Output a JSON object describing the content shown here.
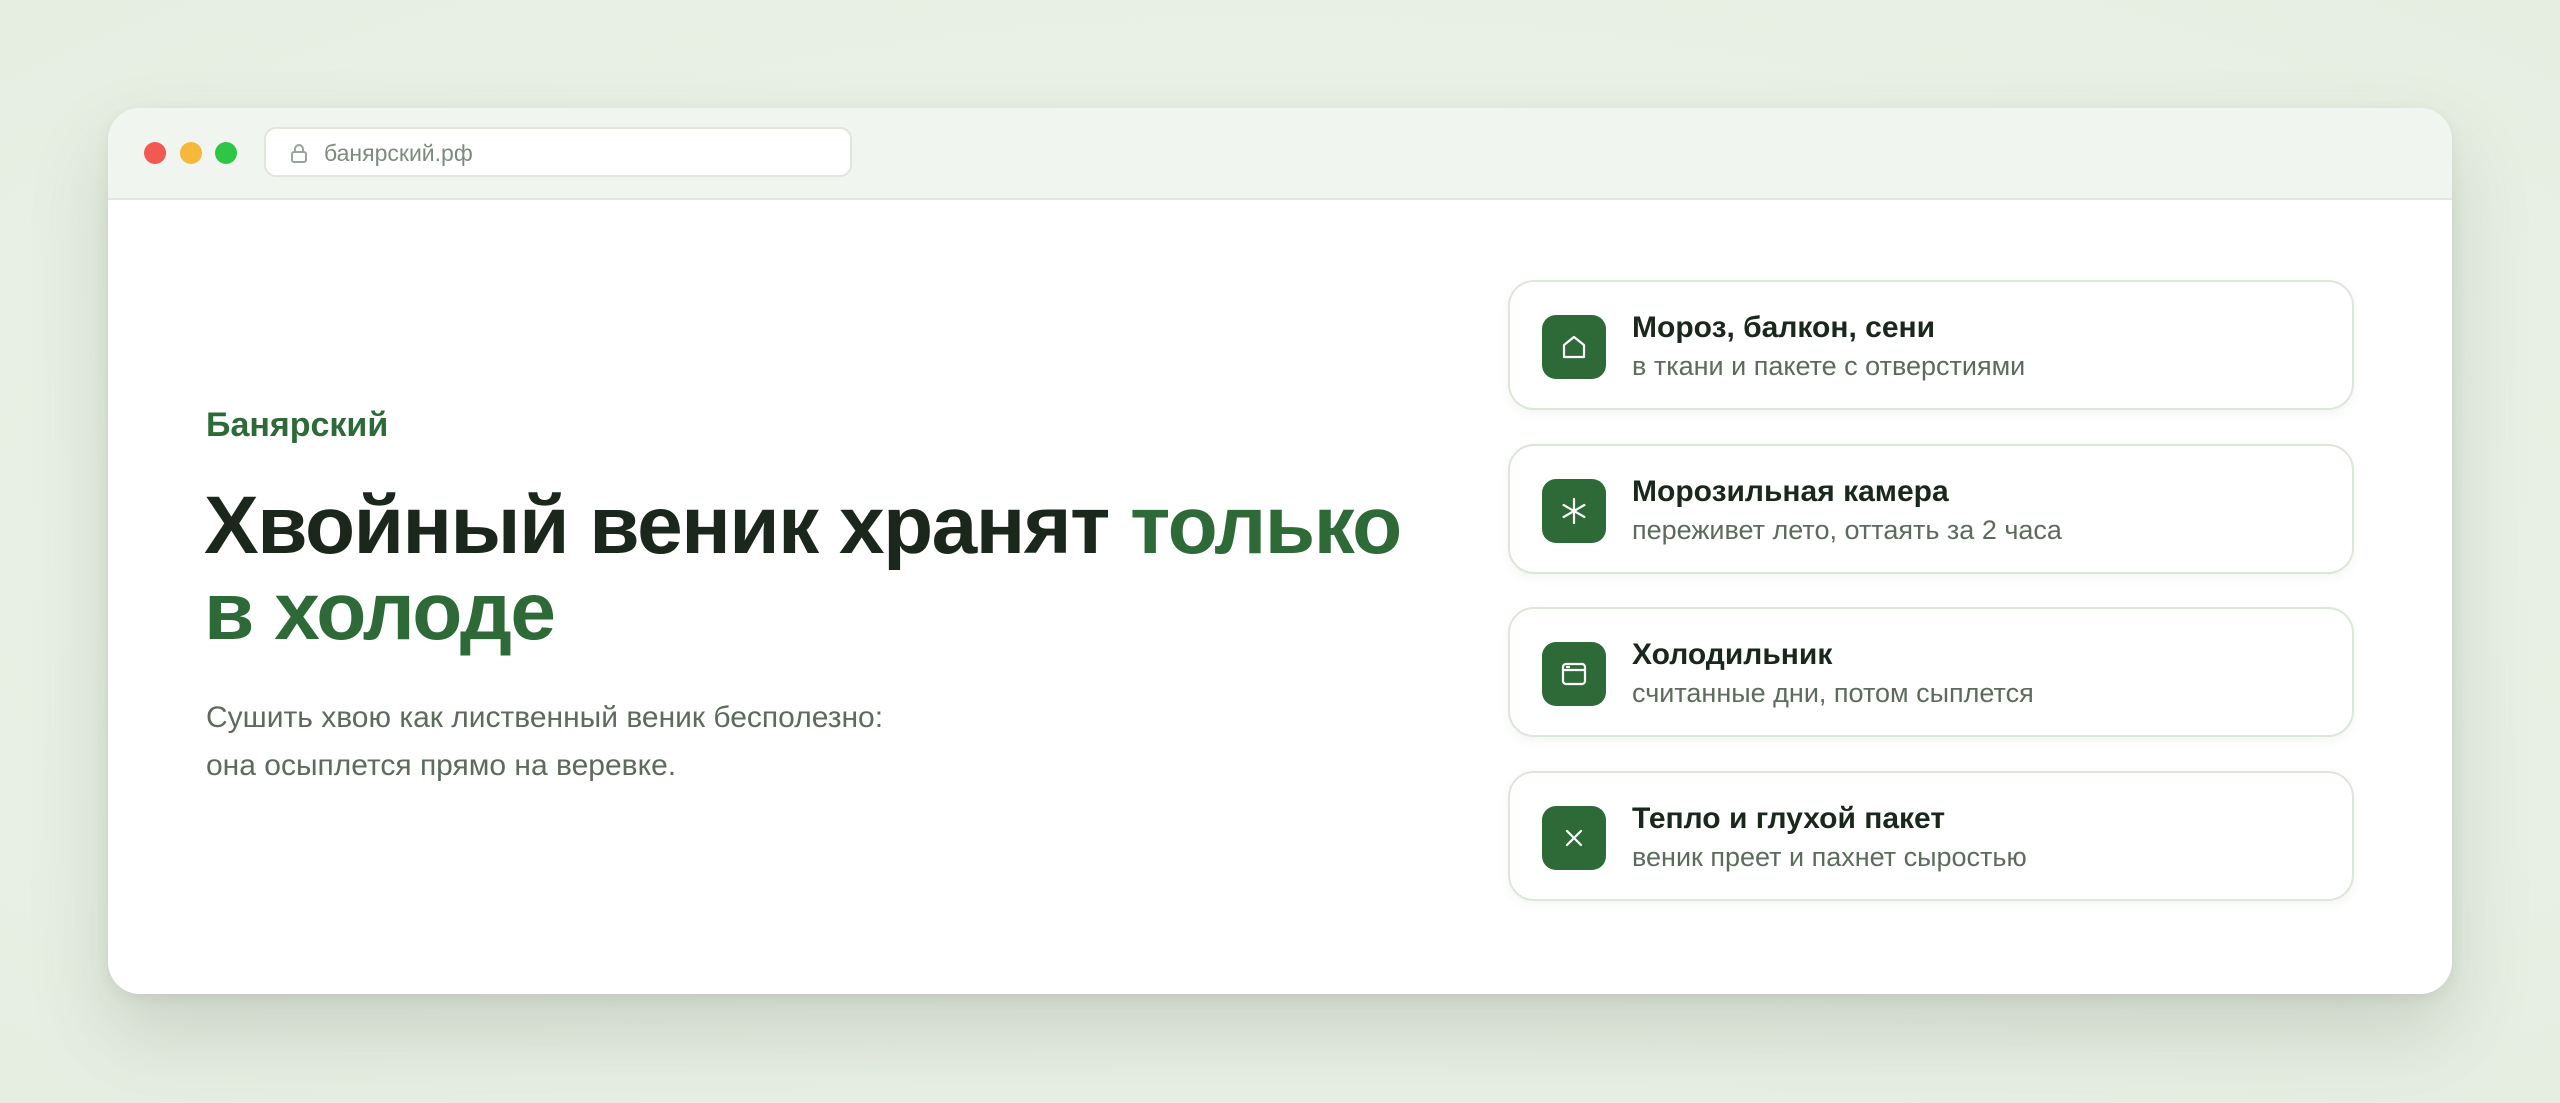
{
  "browser": {
    "url": "банярский.рф"
  },
  "hero": {
    "brand": "Банярский",
    "headline_main": "Хвойный веник хранят ",
    "headline_accent": "только в холоде",
    "lede_line1": "Сушить хвою как лиственный веник бесполезно:",
    "lede_line2": "она осыплется прямо на веревке."
  },
  "storage_options": [
    {
      "icon": "house-icon",
      "title": "Мороз, балкон, сени",
      "description": "в ткани и пакете с отверстиями"
    },
    {
      "icon": "snowflake-icon",
      "title": "Морозильная камера",
      "description": "переживет лето, оттаять за 2 часа"
    },
    {
      "icon": "fridge-icon",
      "title": "Холодильник",
      "description": "считанные дни, потом сыплется"
    },
    {
      "icon": "cross-icon",
      "title": "Тепло и глухой пакет",
      "description": "веник преет и пахнет сыростью"
    }
  ],
  "colors": {
    "accent": "#2d6a37",
    "text_dark": "#1b271d",
    "text_muted": "#5d6a5d",
    "page_bg": "#e9f0e6"
  }
}
